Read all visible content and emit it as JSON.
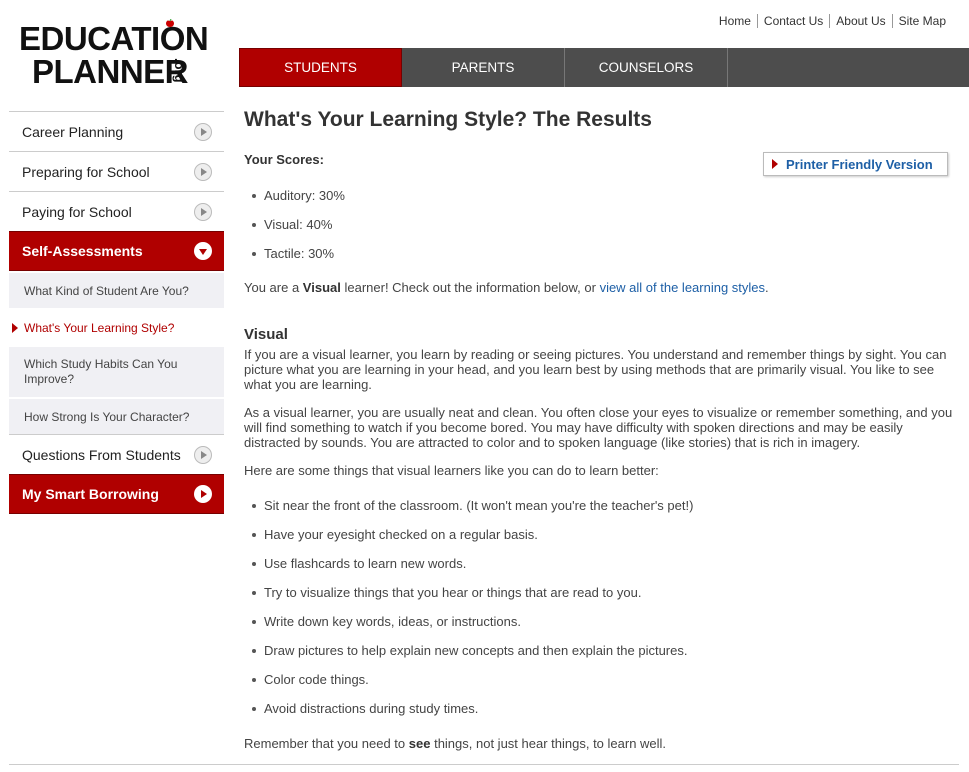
{
  "logo": {
    "line1": "EDUCATION",
    "line2": "PLANNER",
    "suffix": ".org"
  },
  "top_links": [
    "Home",
    "Contact Us",
    "About Us",
    "Site Map"
  ],
  "tabs": [
    {
      "label": "STUDENTS",
      "active": true
    },
    {
      "label": "PARENTS",
      "active": false
    },
    {
      "label": "COUNSELORS",
      "active": false
    }
  ],
  "sidebar": {
    "career_planning": "Career Planning",
    "preparing": "Preparing for School",
    "paying": "Paying for School",
    "self_assessments": "Self-Assessments",
    "sub_items": [
      "What Kind of Student Are You?",
      "What's Your Learning Style?",
      "Which Study Habits Can You Improve?",
      "How Strong Is Your Character?"
    ],
    "questions": "Questions From Students",
    "borrowing": "My Smart Borrowing"
  },
  "main": {
    "title": "What's Your Learning Style? The Results",
    "scores_label": "Your Scores:",
    "printer_label": "Printer Friendly Version",
    "scores": [
      "Auditory: 30%",
      "Visual: 40%",
      "Tactile: 30%"
    ],
    "result_prefix": "You are a ",
    "result_style": "Visual",
    "result_mid": " learner! Check out the information below, or ",
    "result_link": "view all of the learning styles",
    "result_end": ".",
    "section_heading": "Visual",
    "para1": "If you are a visual learner, you learn by reading or seeing pictures. You understand and remember things by sight. You can picture what you are learning in your head, and you learn best by using methods that are primarily visual. You like to see what you are learning.",
    "para2": "As a visual learner, you are usually neat and clean. You often close your eyes to visualize or remember something, and you will find something to watch if you become bored. You may have difficulty with spoken directions and may be easily distracted by sounds. You are attracted to color and to spoken language (like stories) that is rich in imagery.",
    "para3": "Here are some things that visual learners like you can do to learn better:",
    "tips": [
      "Sit near the front of the classroom. (It won't mean you're the teacher's pet!)",
      "Have your eyesight checked on a regular basis.",
      "Use flashcards to learn new words.",
      "Try to visualize things that you hear or things that are read to you.",
      "Write down key words, ideas, or instructions.",
      "Draw pictures to help explain new concepts and then explain the pictures.",
      "Color code things.",
      "Avoid distractions during study times."
    ],
    "closing_prefix": "Remember that you need to ",
    "closing_bold": "see",
    "closing_end": " things, not just hear things, to learn well."
  },
  "colors": {
    "brand_red": "#b00000",
    "nav_gray": "#4d4d4d",
    "link_blue": "#1d5fa6"
  }
}
